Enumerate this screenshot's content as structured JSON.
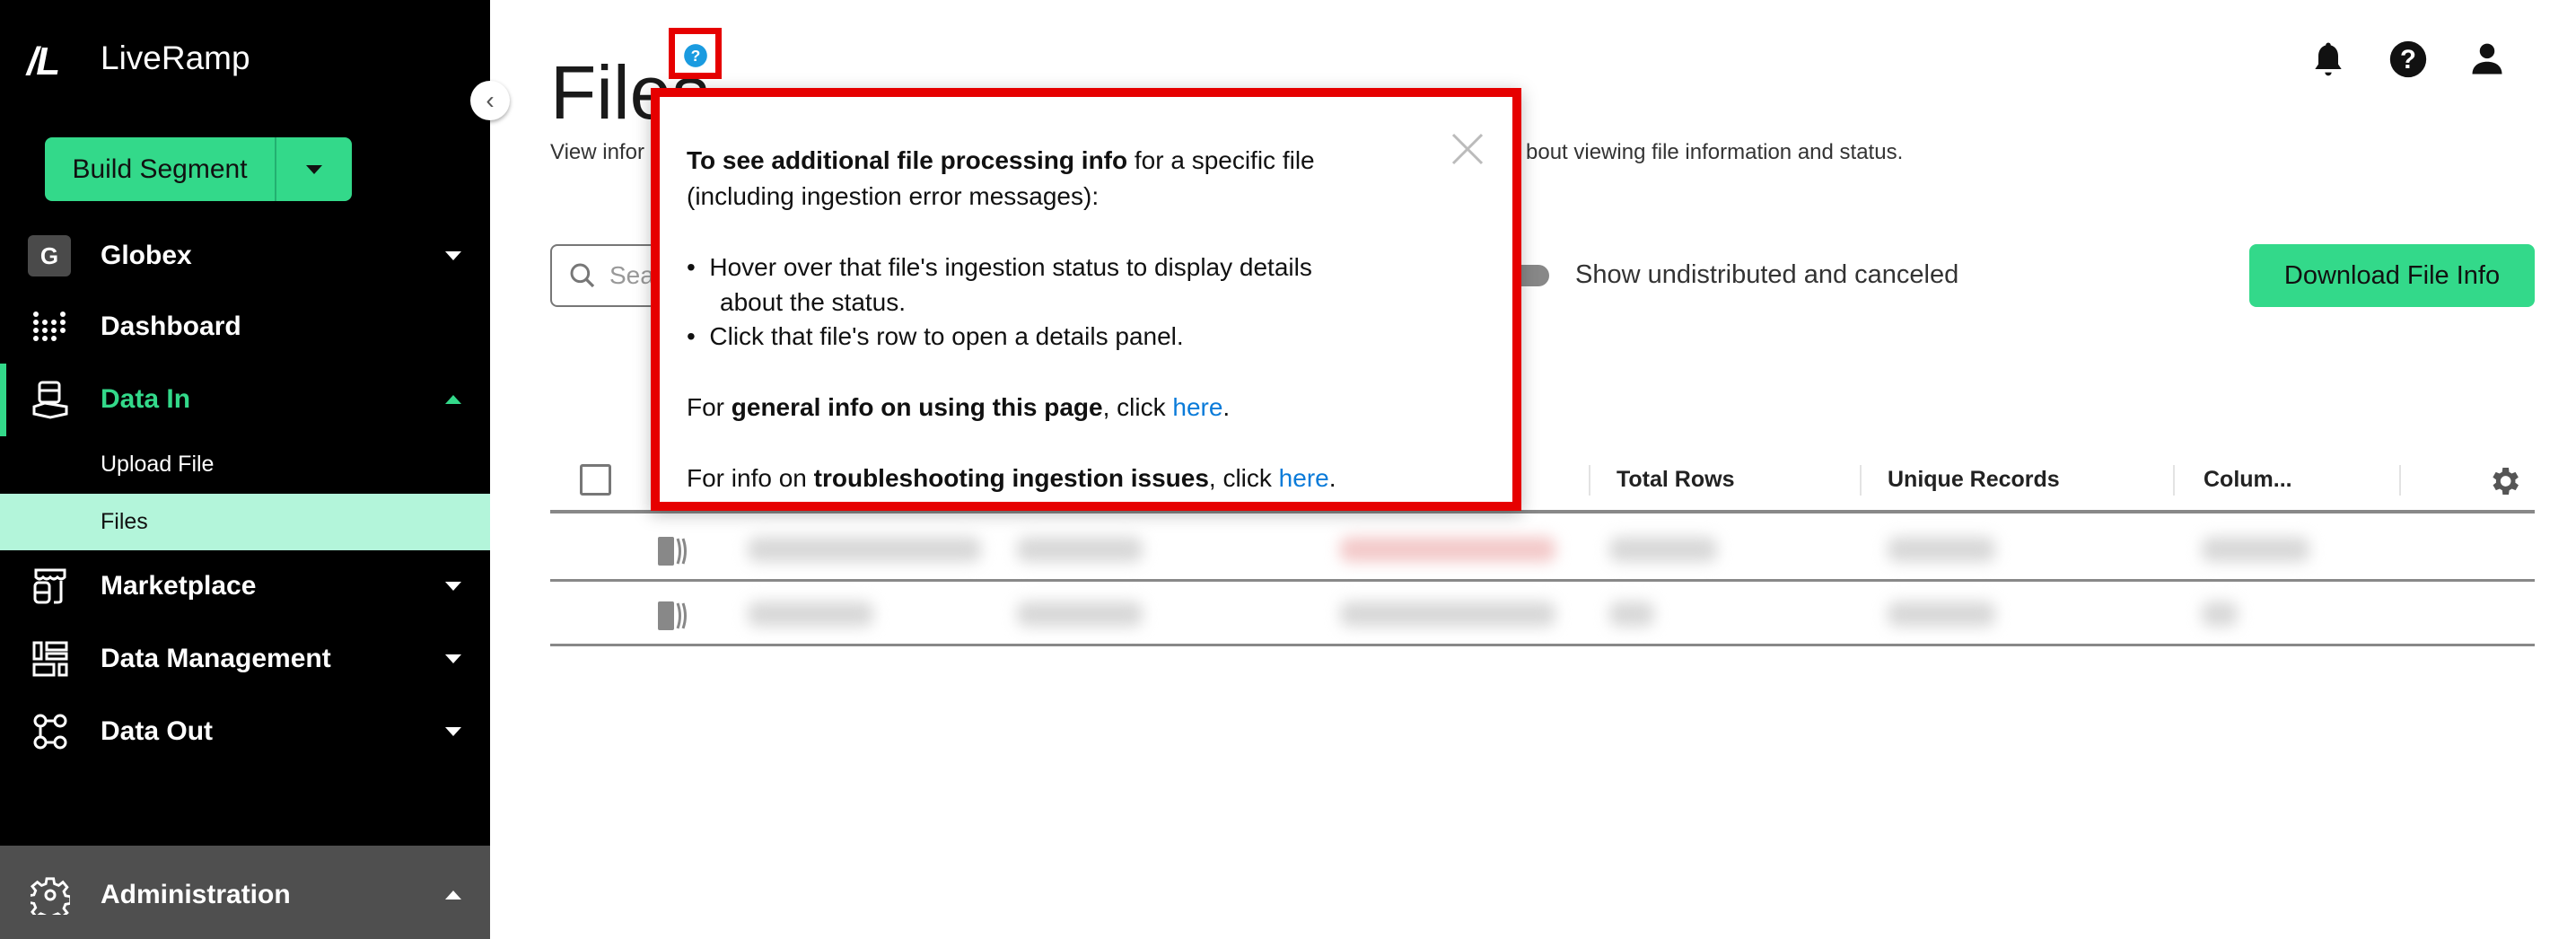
{
  "brand": {
    "logo_mark": "/L",
    "name": "LiveRamp"
  },
  "sidebar": {
    "build_segment": "Build Segment",
    "org": {
      "initial": "G",
      "label": "Globex"
    },
    "items": [
      {
        "label": "Dashboard",
        "icon": "dashboard-dots-icon"
      },
      {
        "label": "Data In",
        "icon": "data-in-icon",
        "active": true
      },
      {
        "label": "Marketplace",
        "icon": "marketplace-icon"
      },
      {
        "label": "Data Management",
        "icon": "data-management-icon"
      },
      {
        "label": "Data Out",
        "icon": "data-out-icon"
      }
    ],
    "subitems": [
      {
        "label": "Upload File"
      },
      {
        "label": "Files",
        "selected": true
      }
    ],
    "admin": "Administration"
  },
  "page": {
    "title": "Files",
    "subtitle_left": "View infor",
    "subtitle_right": "bout viewing file information and status.",
    "search_placeholder": "Sea",
    "toggle_label": "Show undistributed and canceled",
    "download_button": "Download File Info"
  },
  "table": {
    "columns": [
      "Total Rows",
      "Unique Records",
      "Colum..."
    ]
  },
  "popover": {
    "p1_bold": "To see additional file processing info",
    "p1_rest": " for a specific file",
    "p1_line2": "(including ingestion error messages):",
    "bullet1_line1": "Hover over that file's ingestion status to display details",
    "bullet1_line2": "about the status.",
    "bullet2": "Click that file's row to open a details panel.",
    "p2_pre": "For ",
    "p2_bold": "general info on using this page",
    "p2_mid": ", click ",
    "p2_link": "here",
    "p2_end": ".",
    "p3_pre": "For info on ",
    "p3_bold": "troubleshooting ingestion issues",
    "p3_mid": ", click ",
    "p3_link": "here",
    "p3_end": "."
  },
  "colors": {
    "accent": "#33d98a",
    "selected_bg": "#b3f5da",
    "highlight": "#e60000",
    "link": "#0a7bd9",
    "help_icon": "#1a9be0"
  }
}
